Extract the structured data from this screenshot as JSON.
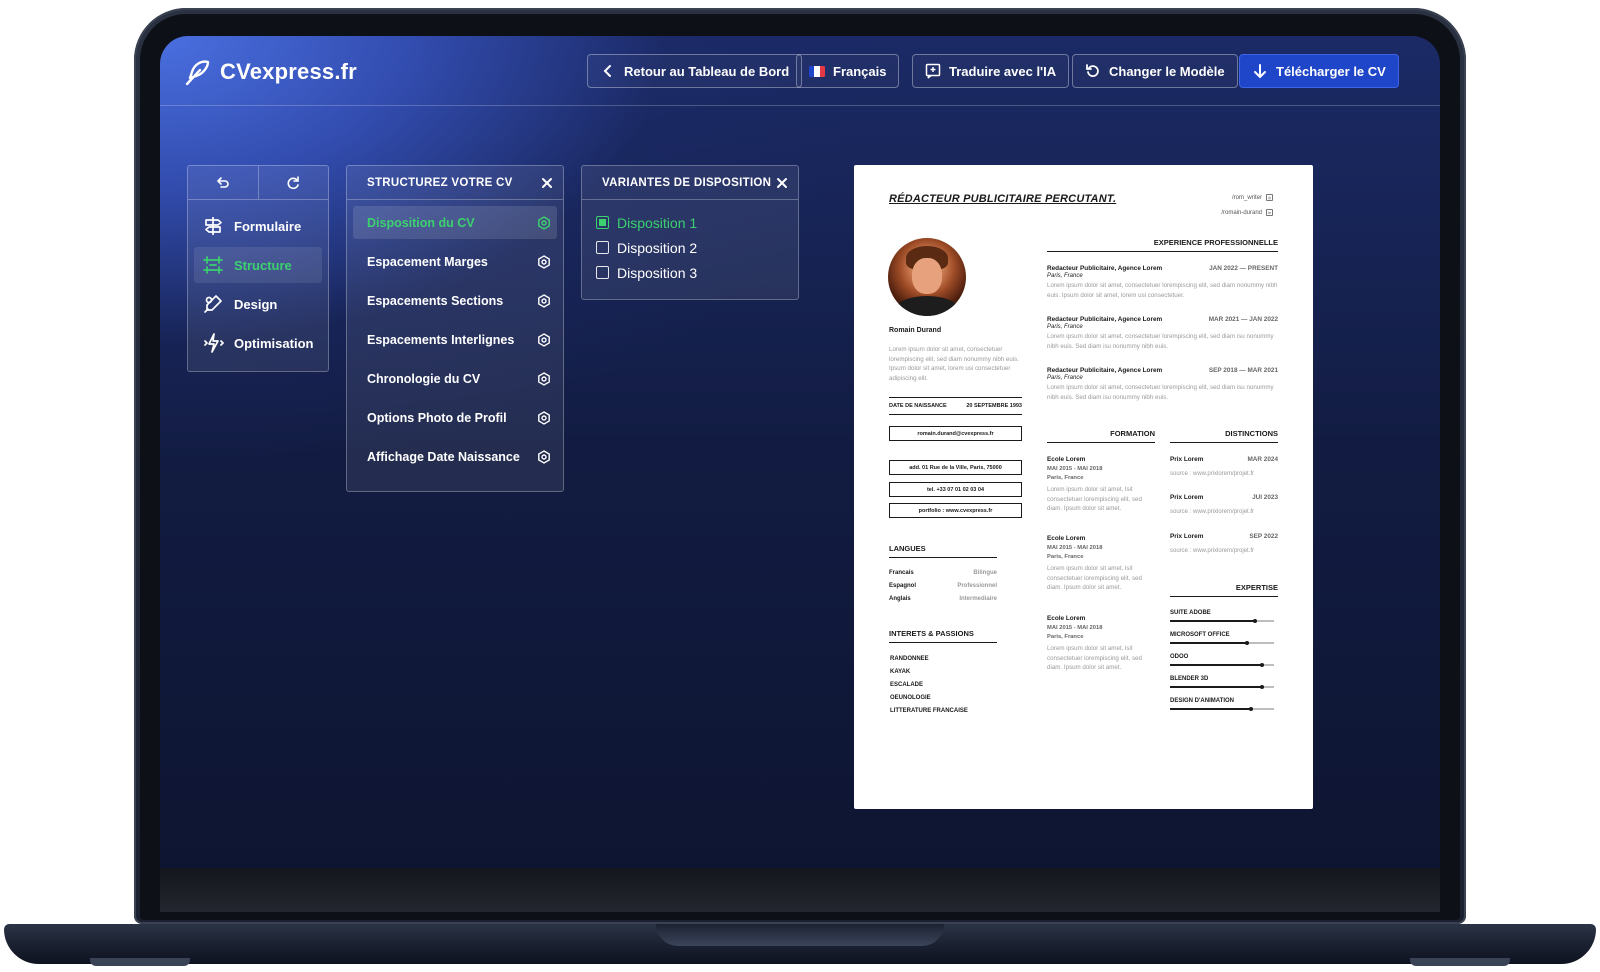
{
  "app": {
    "logo_text": "CVexpress.fr"
  },
  "header": {
    "back_label": "Retour au Tableau de Bord",
    "language_label": "Français",
    "translate_label": "Traduire avec l'IA",
    "template_label": "Changer le Modèle",
    "download_label": "Télécharger le CV",
    "accent_color": "#1f46c9"
  },
  "sidebar": {
    "items": [
      {
        "label": "Formulaire",
        "icon": "signpost-icon",
        "active": false
      },
      {
        "label": "Structure",
        "icon": "layout-icon",
        "active": true
      },
      {
        "label": "Design",
        "icon": "palette-icon",
        "active": false
      },
      {
        "label": "Optimisation",
        "icon": "optimize-icon",
        "active": false
      }
    ],
    "active_color": "#3bd16f"
  },
  "structure_panel": {
    "title": "STRUCTUREZ VOTRE CV",
    "items": [
      {
        "label": "Disposition du CV",
        "active": true
      },
      {
        "label": "Espacement Marges",
        "active": false
      },
      {
        "label": "Espacements Sections",
        "active": false
      },
      {
        "label": "Espacements Interlignes",
        "active": false
      },
      {
        "label": "Chronologie du CV",
        "active": false
      },
      {
        "label": "Options Photo de Profil",
        "active": false
      },
      {
        "label": "Affichage Date Naissance",
        "active": false
      }
    ]
  },
  "variants_panel": {
    "title": "VARIANTES DE DISPOSITION",
    "options": [
      {
        "label": "Disposition 1",
        "checked": true
      },
      {
        "label": "Disposition 2",
        "checked": false
      },
      {
        "label": "Disposition 3",
        "checked": false
      }
    ]
  },
  "cv": {
    "title": "RÉDACTEUR PUBLICITAIRE PERCUTANT.",
    "social": [
      "/rom_writer",
      "/romain-durand"
    ],
    "name": "Romain Durand",
    "about": "Lorem ipsum dolor sit amet, consectetuer lorempiscing elit, sed diam nonummy nibh euis. Ipsum dolor sit amet, lorem usi consectetuer adipiscing elit.",
    "dob_label": "DATE DE NAISSANCE",
    "dob_value": "20 SEPTEMBRE 1993",
    "email": "romain.durand@cvexpress.fr",
    "address": "add. 01 Rue de la Ville, Paris, 75000",
    "phone": "tel. +33 07 01 02 03 04",
    "portfolio": "portfolio : www.cvexpress.fr",
    "languages_title": "LANGUES",
    "languages": [
      {
        "name": "Francais",
        "level": "Bilingue"
      },
      {
        "name": "Espagnol",
        "level": "Professionnel"
      },
      {
        "name": "Anglais",
        "level": "Intermediaire"
      }
    ],
    "interests_title": "INTERETS & PASSIONS",
    "interests": [
      "RANDONNEE",
      "KAYAK",
      "ESCALADE",
      "OEUNOLOGIE",
      "LITTERATURE FRANCAISE"
    ],
    "experience_title": "EXPERIENCE PROFESSIONNELLE",
    "experience": [
      {
        "role": "Redacteur Publicitaire, Agence Lorem",
        "dates": "JAN 2022 — PRESENT",
        "location": "Paris, France",
        "desc": "Lorem ipsum dolor sit amet, consectetuer lorempiscing elit, sed diam nonummy nibh euis. Ipsum dolor sit amet, lorem usi consectetuer."
      },
      {
        "role": "Redacteur Publicitaire, Agence Lorem",
        "dates": "MAR 2021 — JAN 2022",
        "location": "Paris, France",
        "desc": "Lorem ipsum dolor sit amet, consectetuer lorempiscing elit, sed diam isu nonummy nibh euis. Sed diam isu nonummy nibh euis."
      },
      {
        "role": "Redacteur Publicitaire, Agence Lorem",
        "dates": "SEP 2018 — MAR 2021",
        "location": "Paris, France",
        "desc": "Lorem ipsum dolor sit amet, consectetuer lorempiscing elit, sed diam isu nonummy nibh euis. Sed diam isu nonummy nibh euis."
      }
    ],
    "education_title": "FORMATION",
    "education": [
      {
        "school": "Ecole Lorem",
        "dates": "MAI 2015 - MAI 2018",
        "location": "Paris, France",
        "desc": "Lorem ipsum dolor sit amet, lsit consectetuer lorempiscing elit, sed diam. Ipsum dolor sit amet."
      },
      {
        "school": "Ecole Lorem",
        "dates": "MAI 2015 - MAI 2018",
        "location": "Paris, France",
        "desc": "Lorem ipsum dolor sit amet, lsit consectetuer lorempiscing elit, sed diam. Ipsum dolor sit amet."
      },
      {
        "school": "Ecole Lorem",
        "dates": "MAI 2015 - MAI 2018",
        "location": "Paris, France",
        "desc": "Lorem ipsum dolor sit amet, lsit consectetuer lorempiscing elit, sed diam. Ipsum dolor sit amet."
      }
    ],
    "awards_title": "DISTINCTIONS",
    "awards": [
      {
        "name": "Prix Lorem",
        "date": "MAR 2024",
        "source": "source : www.prixlorem/projet.fr"
      },
      {
        "name": "Prix Lorem",
        "date": "JUI 2023",
        "source": "source : www.prixlorem/projet.fr"
      },
      {
        "name": "Prix Lorem",
        "date": "SEP 2022",
        "source": "source : www.prixlorem/projet.fr"
      }
    ],
    "expertise_title": "EXPERTISE",
    "skills": [
      {
        "name": "SUITE ADOBE",
        "level": 0.82
      },
      {
        "name": "MICROSOFT OFFICE",
        "level": 0.74
      },
      {
        "name": "ODOO",
        "level": 0.88
      },
      {
        "name": "BLENDER 3D",
        "level": 0.88
      },
      {
        "name": "DESIGN D'ANIMATION",
        "level": 0.78
      }
    ]
  }
}
